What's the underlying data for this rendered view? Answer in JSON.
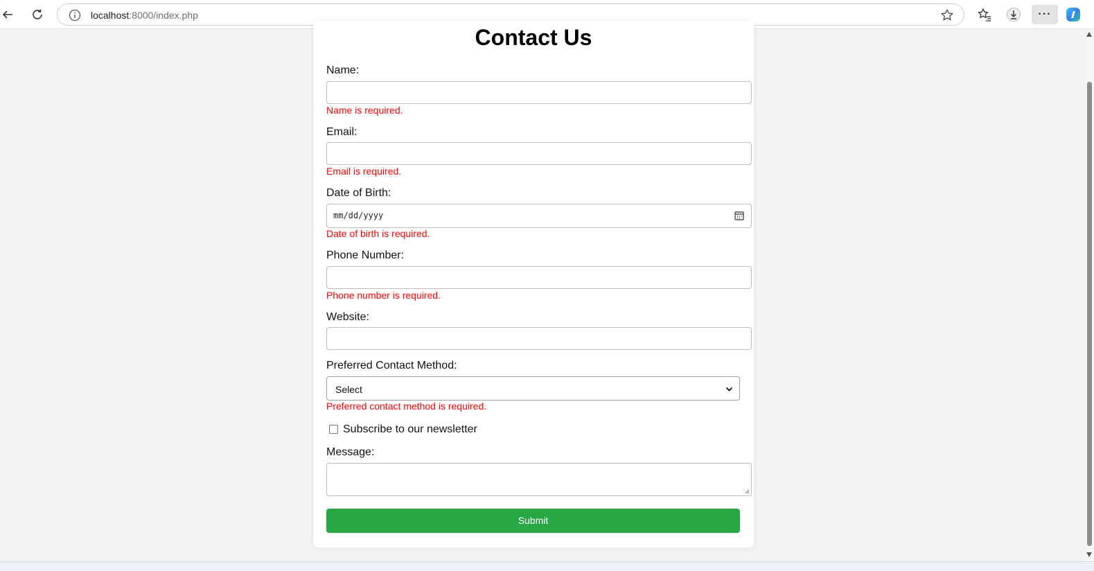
{
  "browser": {
    "url_host": "localhost",
    "url_path": ":8000/index.php"
  },
  "form": {
    "title": "Contact Us",
    "name": {
      "label": "Name:",
      "value": "",
      "error": "Name is required."
    },
    "email": {
      "label": "Email:",
      "value": "",
      "error": "Email is required."
    },
    "dob": {
      "label": "Date of Birth:",
      "placeholder": "mm/dd/yyyy",
      "error": "Date of birth is required."
    },
    "phone": {
      "label": "Phone Number:",
      "value": "",
      "error": "Phone number is required."
    },
    "website": {
      "label": "Website:",
      "value": ""
    },
    "contact_method": {
      "label": "Preferred Contact Method:",
      "selected": "Select",
      "error": "Preferred contact method is required."
    },
    "newsletter": {
      "label": "Subscribe to our newsletter",
      "checked": false
    },
    "message": {
      "label": "Message:",
      "value": ""
    },
    "submit_label": "Submit"
  },
  "colors": {
    "error": "#ff0000",
    "submit_bg": "#28a745",
    "page_bg": "#f3f3f3"
  }
}
